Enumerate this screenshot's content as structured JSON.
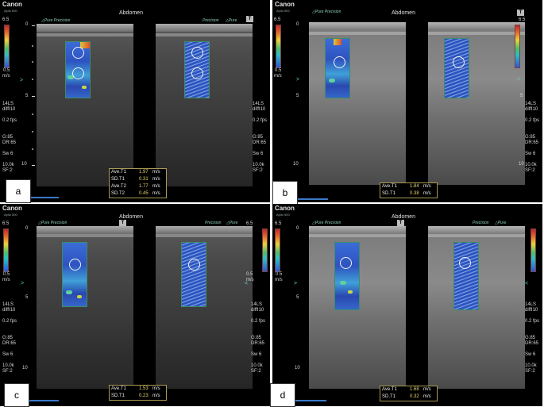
{
  "brand": "Canon",
  "model": "Aplio 500",
  "exam": "Abdomen",
  "pure_precision": "△Pure Precision",
  "precision": "Precision",
  "pure": "△Pure",
  "t_button": "T",
  "colorbar": {
    "top": "6.5",
    "bottom": "0.5",
    "unit": "m/s"
  },
  "scale": {
    "zero": "0",
    "five": "5",
    "ten": "10"
  },
  "params": [
    "14LS",
    "diffI10",
    "0.2 fps",
    "G:85",
    "DR:65",
    "Sw 6",
    "10.0k",
    "SF:2"
  ],
  "panels": [
    {
      "label": "a",
      "measurements": [
        {
          "label": "Ave.T1",
          "value": "1.97",
          "unit": "m/s"
        },
        {
          "label": "SD.T1",
          "value": "0.31",
          "unit": "m/s"
        },
        {
          "label": "Ave.T2",
          "value": "1.77",
          "unit": "m/s"
        },
        {
          "label": "SD.T2",
          "value": "0.45",
          "unit": "m/s"
        }
      ]
    },
    {
      "label": "b",
      "measurements": [
        {
          "label": "Ave.T1",
          "value": "1.84",
          "unit": "m/s"
        },
        {
          "label": "SD.T1",
          "value": "0.38",
          "unit": "m/s"
        }
      ]
    },
    {
      "label": "c",
      "measurements": [
        {
          "label": "Ave.T1",
          "value": "1.53",
          "unit": "m/s"
        },
        {
          "label": "SD.T1",
          "value": "0.23",
          "unit": "m/s"
        }
      ]
    },
    {
      "label": "d",
      "measurements": [
        {
          "label": "Ave.T1",
          "value": "1.68",
          "unit": "m/s"
        },
        {
          "label": "SD.T1",
          "value": "0.32",
          "unit": "m/s"
        }
      ]
    }
  ]
}
